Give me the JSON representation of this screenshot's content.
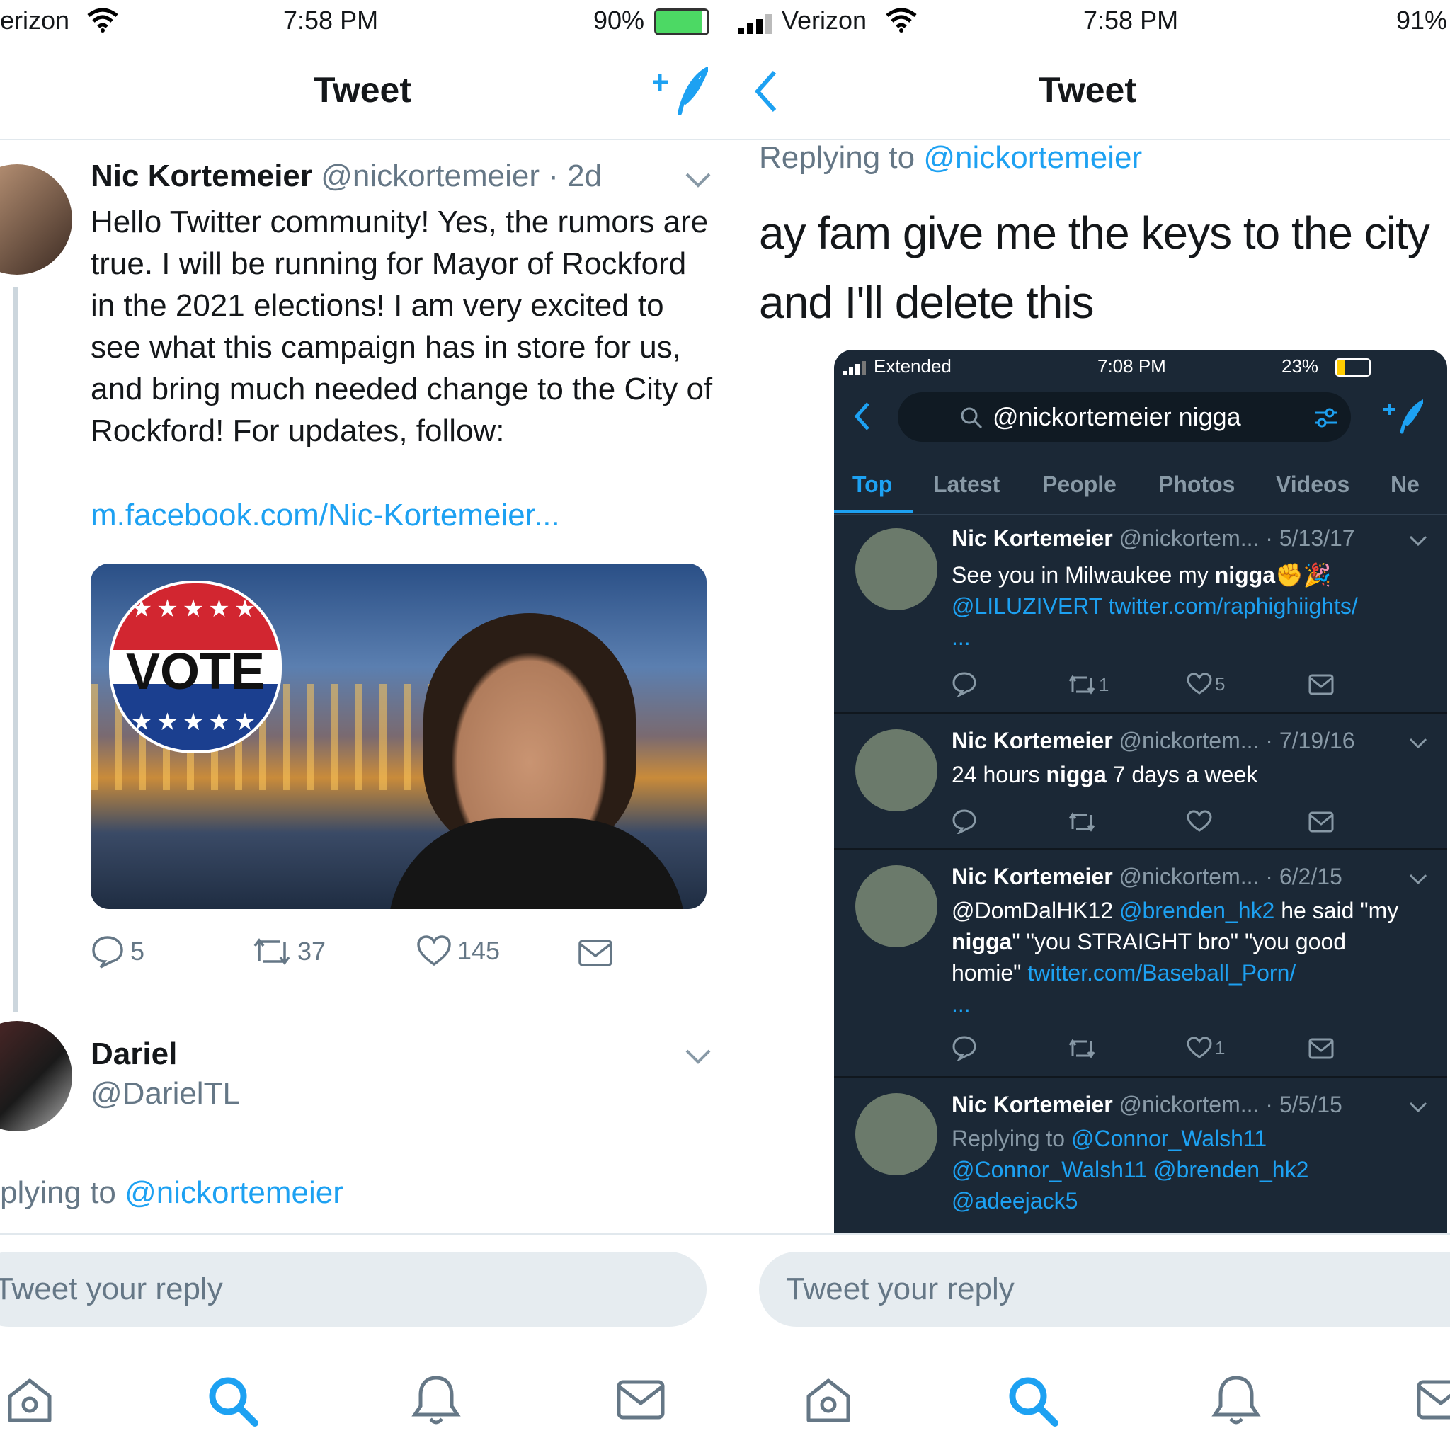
{
  "left": {
    "status": {
      "carrier": "erizon",
      "time": "7:58 PM",
      "battery": "90%"
    },
    "nav_title": "Tweet",
    "tweet": {
      "name": "Nic Kortemeier",
      "handle": "@nickortemeier",
      "age": "· 2d",
      "text": "Hello Twitter community! Yes, the rumors are true. I will be running for Mayor of Rockford in the 2021 elections! I am very excited to see what this campaign has in store for us, and bring much needed change to the City of Rockford! For updates, follow:",
      "link": "m.facebook.com/Nic-Kortemeier...",
      "media_label": "VOTE",
      "replies": "5",
      "retweets": "37",
      "likes": "145"
    },
    "reply": {
      "name": "Dariel",
      "handle": "@DarielTL"
    },
    "replying_prefix": "plying to",
    "replying_handle": "@nickortemeier",
    "reply_placeholder": "Tweet your reply"
  },
  "right": {
    "status": {
      "carrier": "Verizon",
      "time": "7:58 PM",
      "battery": "91%"
    },
    "nav_title": "Tweet",
    "replying_prefix": "Replying to",
    "replying_handle": "@nickortemeier",
    "text": "ay fam give me the keys to the city and I'll delete this",
    "reply_placeholder": "Tweet your reply",
    "embed": {
      "status": {
        "carrier": "Extended",
        "time": "7:08 PM",
        "battery": "23%"
      },
      "search_query": "@nickortemeier nigga",
      "tabs": [
        "Top",
        "Latest",
        "People",
        "Photos",
        "Videos",
        "Ne"
      ],
      "results": [
        {
          "name": "Nic Kortemeier",
          "handle": "@nickortem...",
          "date": "· 5/13/17",
          "text": "See you in Milwaukee my ",
          "bold": "nigga",
          "emoji": "✊🎉",
          "links": "@LILUZIVERT twitter.com/raphighiights/",
          "more": "...",
          "retweets": "1",
          "likes": "5"
        },
        {
          "name": "Nic Kortemeier",
          "handle": "@nickortem...",
          "date": "· 7/19/16",
          "pre": "24 hours ",
          "bold": "nigga",
          "post": " 7 days a week"
        },
        {
          "name": "Nic Kortemeier",
          "handle": "@nickortem...",
          "date": "· 6/2/15",
          "mention1": "@DomDalHK12",
          "mention2": "@brenden_hk2",
          "said": " he said",
          "quote_pre": "\"my ",
          "bold": "nigga",
          "quote_post": "\" \"you STRAIGHT bro\" \"you good homie\"",
          "link": "twitter.com/Baseball_Porn/",
          "more": "...",
          "likes": "1"
        },
        {
          "name": "Nic Kortemeier",
          "handle": "@nickortem...",
          "date": "· 5/5/15",
          "replying_prefix": "Replying to",
          "replying_handle": "@Connor_Walsh11",
          "mentions": "@Connor_Walsh11 @brenden_hk2 @adeejack5"
        }
      ]
    }
  },
  "colors": {
    "accent": "#1da1f2",
    "dark_bg": "#1b2836"
  }
}
